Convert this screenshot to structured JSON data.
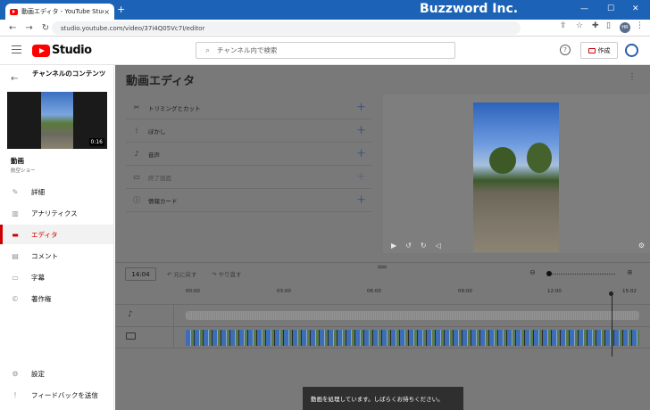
{
  "browser": {
    "tab_title": "動画エディタ - YouTube Studio",
    "tab_close": "×",
    "new_tab": "+",
    "url": "studio.youtube.com/video/37i4Q05Vc7I/editor",
    "profile_initials": "HR",
    "watermark": "Buzzword Inc."
  },
  "header": {
    "logo_text": "Studio",
    "search_placeholder": "チャンネル内で検索",
    "help": "?",
    "create_label": "作成"
  },
  "sidebar": {
    "title": "チャンネルのコンテンツ",
    "duration": "0:16",
    "video_label": "動画",
    "video_sub": "航空ショー",
    "items": [
      {
        "label": "詳細",
        "icon": "pencil-icon",
        "glyph": "✎"
      },
      {
        "label": "アナリティクス",
        "icon": "analytics-icon",
        "glyph": "▥"
      },
      {
        "label": "エディタ",
        "icon": "editor-icon",
        "glyph": "▬"
      },
      {
        "label": "コメント",
        "icon": "comment-icon",
        "glyph": "▤"
      },
      {
        "label": "字幕",
        "icon": "subtitles-icon",
        "glyph": "▭"
      },
      {
        "label": "著作権",
        "icon": "copyright-icon",
        "glyph": "©"
      }
    ],
    "settings": "設定",
    "feedback": "フィードバックを送信"
  },
  "editor": {
    "title": "動画エディタ",
    "tools": [
      {
        "label": "トリミングとカット",
        "icon": "scissors-icon",
        "glyph": "✂"
      },
      {
        "label": "ぼかし",
        "icon": "blur-icon",
        "glyph": "⁞"
      },
      {
        "label": "音声",
        "icon": "music-icon",
        "glyph": "♪"
      },
      {
        "label": "終了画面",
        "icon": "endscreen-icon",
        "glyph": "▭"
      },
      {
        "label": "情報カード",
        "icon": "info-icon",
        "glyph": "ⓘ"
      }
    ],
    "time": "14:04",
    "undo": "元に戻す",
    "redo": "やり直す",
    "timeline_ticks": [
      "00:00",
      "03:00",
      "06:00",
      "09:00",
      "12:00",
      "15:02"
    ],
    "toast": "動画を処理しています。しばらくお待ちください。"
  }
}
